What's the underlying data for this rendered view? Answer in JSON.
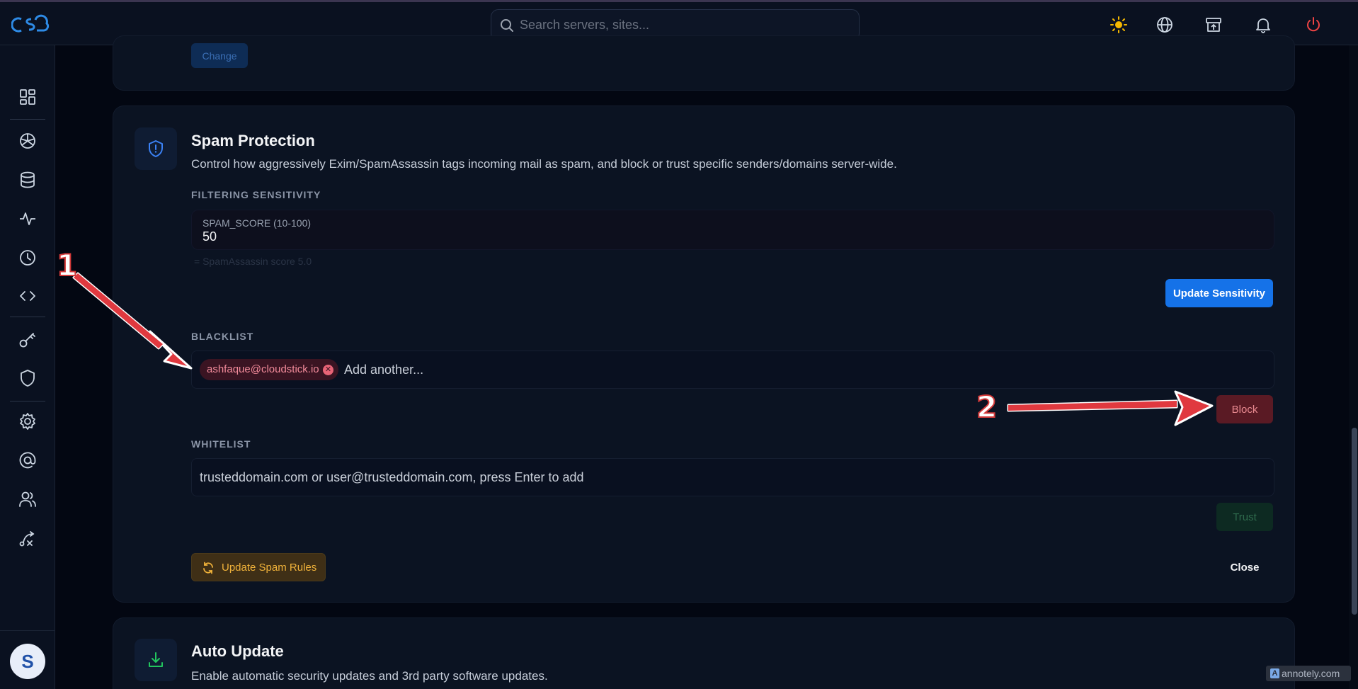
{
  "header": {
    "search_placeholder": "Search servers, sites..."
  },
  "top_card": {
    "change_label": "Change"
  },
  "spam_protection": {
    "title": "Spam Protection",
    "description": "Control how aggressively Exim/SpamAssassin tags incoming mail as spam, and block or trust specific senders/domains server-wide.",
    "filtering_label": "FILTERING SENSITIVITY",
    "spam_score_label": "SPAM_SCORE (10-100)",
    "spam_score_value": "50",
    "score_hint": "= SpamAssassin score 5.0",
    "update_sensitivity_label": "Update Sensitivity",
    "blacklist_label": "BLACKLIST",
    "blacklist_chips": [
      "ashfaque@cloudstick.io"
    ],
    "blacklist_placeholder": "Add another...",
    "block_label": "Block",
    "whitelist_label": "WHITELIST",
    "whitelist_placeholder": "trusteddomain.com or user@trusteddomain.com, press Enter to add",
    "trust_label": "Trust",
    "update_rules_label": "Update Spam Rules",
    "close_label": "Close"
  },
  "auto_update": {
    "title": "Auto Update",
    "description": "Enable automatic security updates and 3rd party software updates."
  },
  "annotations": {
    "marker_1": "1",
    "marker_2": "2",
    "color": "#e0393f"
  },
  "avatar_letter": "S",
  "watermark": "annotely.com",
  "colors": {
    "accent_blue": "#1572e8",
    "danger": "#e98a91",
    "warning": "#f0b23a",
    "power": "#ef4444"
  }
}
